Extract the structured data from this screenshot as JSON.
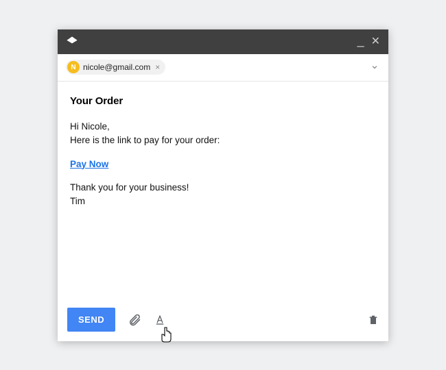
{
  "recipient": {
    "initial": "N",
    "email": "nicole@gmail.com"
  },
  "subject": "Your Order",
  "body": {
    "greeting": "Hi Nicole,",
    "line1": "Here is the link to pay for your order:",
    "link_text": "Pay Now",
    "closing1": "Thank you for your business!",
    "closing2": "Tim"
  },
  "toolbar": {
    "send_label": "SEND"
  }
}
